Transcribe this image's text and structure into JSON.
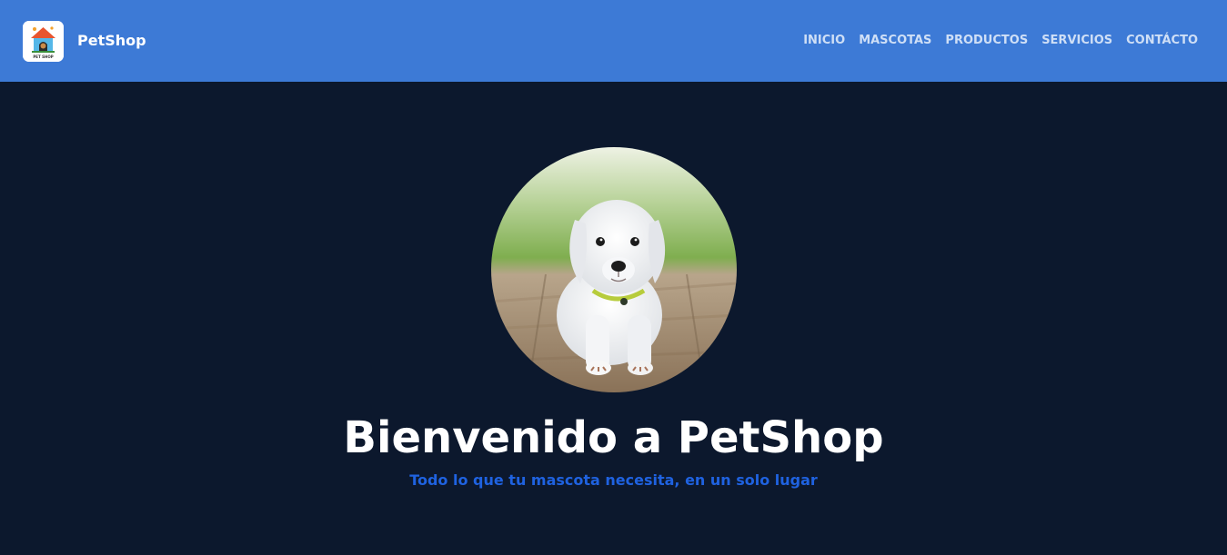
{
  "brand": {
    "name": "PetShop",
    "logo_icon": "pet-house-logo-icon",
    "logo_text": "PET SHOP"
  },
  "nav": {
    "items": [
      {
        "label": "INICIO"
      },
      {
        "label": "MASCOTAS"
      },
      {
        "label": "PRODUCTOS"
      },
      {
        "label": "SERVICIOS"
      },
      {
        "label": "CONTÁCTO"
      }
    ]
  },
  "hero": {
    "image_subject": "dog",
    "title": "Bienvenido a PetShop",
    "subtitle": "Todo lo que tu mascota necesita, en un solo lugar"
  },
  "colors": {
    "navbar": "#3d7ad6",
    "background": "#0c182d",
    "accent": "#1f62e0"
  }
}
